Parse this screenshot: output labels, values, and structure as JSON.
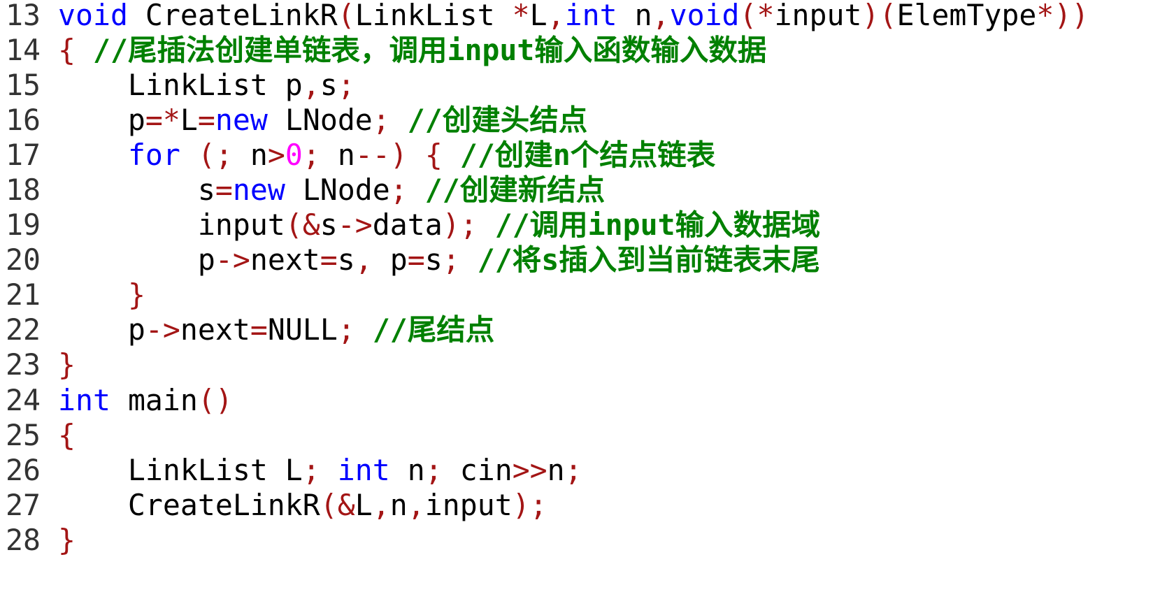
{
  "editor": {
    "colors": {
      "keyword": "#0000ff",
      "punctuation": "#a31515",
      "comment": "#008000",
      "number": "#ff00ff",
      "text": "#000000",
      "line_number": "#333333"
    },
    "lines": [
      {
        "number": "13",
        "tokens": [
          [
            "k",
            "void"
          ],
          [
            "t",
            " CreateLinkR"
          ],
          [
            "p",
            "("
          ],
          [
            "t",
            "LinkList "
          ],
          [
            "p",
            "*"
          ],
          [
            "t",
            "L"
          ],
          [
            "p",
            ","
          ],
          [
            "k",
            "int"
          ],
          [
            "t",
            " n"
          ],
          [
            "p",
            ","
          ],
          [
            "k",
            "void"
          ],
          [
            "p",
            "(*"
          ],
          [
            "t",
            "input"
          ],
          [
            "p",
            ")("
          ],
          [
            "t",
            "ElemType"
          ],
          [
            "p",
            "*))"
          ]
        ]
      },
      {
        "number": "14",
        "tokens": [
          [
            "p",
            "{"
          ],
          [
            "t",
            " "
          ],
          [
            "c",
            "//尾插法创建单链表，调用input输入函数输入数据"
          ]
        ]
      },
      {
        "number": "15",
        "tokens": [
          [
            "t",
            "    LinkList p"
          ],
          [
            "p",
            ","
          ],
          [
            "t",
            "s"
          ],
          [
            "p",
            ";"
          ]
        ]
      },
      {
        "number": "16",
        "tokens": [
          [
            "t",
            "    p"
          ],
          [
            "p",
            "=*"
          ],
          [
            "t",
            "L"
          ],
          [
            "p",
            "="
          ],
          [
            "k",
            "new"
          ],
          [
            "t",
            " LNode"
          ],
          [
            "p",
            ";"
          ],
          [
            "t",
            " "
          ],
          [
            "c",
            "//创建头结点"
          ]
        ]
      },
      {
        "number": "17",
        "tokens": [
          [
            "t",
            "    "
          ],
          [
            "k",
            "for"
          ],
          [
            "t",
            " "
          ],
          [
            "p",
            "(;"
          ],
          [
            "t",
            " n"
          ],
          [
            "p",
            ">"
          ],
          [
            "n",
            "0"
          ],
          [
            "p",
            ";"
          ],
          [
            "t",
            " n"
          ],
          [
            "p",
            "--)"
          ],
          [
            "t",
            " "
          ],
          [
            "p",
            "{"
          ],
          [
            "t",
            " "
          ],
          [
            "c",
            "//创建n个结点链表"
          ]
        ]
      },
      {
        "number": "18",
        "tokens": [
          [
            "t",
            "        s"
          ],
          [
            "p",
            "="
          ],
          [
            "k",
            "new"
          ],
          [
            "t",
            " LNode"
          ],
          [
            "p",
            ";"
          ],
          [
            "t",
            " "
          ],
          [
            "c",
            "//创建新结点"
          ]
        ]
      },
      {
        "number": "19",
        "tokens": [
          [
            "t",
            "        input"
          ],
          [
            "p",
            "(&"
          ],
          [
            "t",
            "s"
          ],
          [
            "p",
            "->"
          ],
          [
            "t",
            "data"
          ],
          [
            "p",
            ");"
          ],
          [
            "t",
            " "
          ],
          [
            "c",
            "//调用input输入数据域"
          ]
        ]
      },
      {
        "number": "20",
        "tokens": [
          [
            "t",
            "        p"
          ],
          [
            "p",
            "->"
          ],
          [
            "t",
            "next"
          ],
          [
            "p",
            "="
          ],
          [
            "t",
            "s"
          ],
          [
            "p",
            ","
          ],
          [
            "t",
            " p"
          ],
          [
            "p",
            "="
          ],
          [
            "t",
            "s"
          ],
          [
            "p",
            ";"
          ],
          [
            "t",
            " "
          ],
          [
            "c",
            "//将s插入到当前链表末尾"
          ]
        ]
      },
      {
        "number": "21",
        "tokens": [
          [
            "t",
            "    "
          ],
          [
            "p",
            "}"
          ]
        ]
      },
      {
        "number": "22",
        "tokens": [
          [
            "t",
            "    p"
          ],
          [
            "p",
            "->"
          ],
          [
            "t",
            "next"
          ],
          [
            "p",
            "="
          ],
          [
            "t",
            "NULL"
          ],
          [
            "p",
            ";"
          ],
          [
            "t",
            " "
          ],
          [
            "c",
            "//尾结点"
          ]
        ]
      },
      {
        "number": "23",
        "tokens": [
          [
            "p",
            "}"
          ]
        ]
      },
      {
        "number": "24",
        "tokens": [
          [
            "k",
            "int"
          ],
          [
            "t",
            " main"
          ],
          [
            "p",
            "()"
          ]
        ]
      },
      {
        "number": "25",
        "tokens": [
          [
            "p",
            "{"
          ]
        ]
      },
      {
        "number": "26",
        "tokens": [
          [
            "t",
            "    LinkList L"
          ],
          [
            "p",
            ";"
          ],
          [
            "t",
            " "
          ],
          [
            "k",
            "int"
          ],
          [
            "t",
            " n"
          ],
          [
            "p",
            ";"
          ],
          [
            "t",
            " cin"
          ],
          [
            "p",
            ">>"
          ],
          [
            "t",
            "n"
          ],
          [
            "p",
            ";"
          ]
        ]
      },
      {
        "number": "27",
        "tokens": [
          [
            "t",
            "    CreateLinkR"
          ],
          [
            "p",
            "(&"
          ],
          [
            "t",
            "L"
          ],
          [
            "p",
            ","
          ],
          [
            "t",
            "n"
          ],
          [
            "p",
            ","
          ],
          [
            "t",
            "input"
          ],
          [
            "p",
            ");"
          ]
        ]
      },
      {
        "number": "28",
        "tokens": [
          [
            "p",
            "}"
          ]
        ]
      }
    ]
  }
}
